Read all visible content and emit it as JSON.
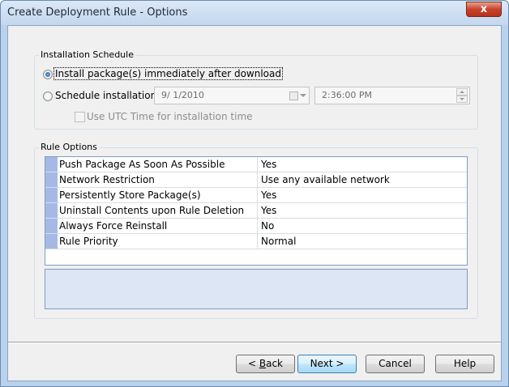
{
  "window": {
    "title": "Create Deployment Rule - Options",
    "close_glyph": "x"
  },
  "installation_schedule": {
    "group_label": "Installation Schedule",
    "immediate_label": "Install package(s) immediately after download",
    "immediate_selected": true,
    "schedule_label": "Schedule installation for",
    "schedule_selected": false,
    "date_value": "9/  1/2010",
    "time_value": "2:36:00 PM",
    "utc_label": "Use UTC Time for installation time",
    "utc_checked": false
  },
  "rule_options": {
    "group_label": "Rule Options",
    "rows": [
      {
        "name": "Push Package As Soon As Possible",
        "value": "Yes"
      },
      {
        "name": "Network Restriction",
        "value": "Use any available network"
      },
      {
        "name": "Persistently Store Package(s)",
        "value": "Yes"
      },
      {
        "name": "Uninstall Contents upon Rule Deletion",
        "value": "Yes"
      },
      {
        "name": "Always Force Reinstall",
        "value": "No"
      },
      {
        "name": "Rule Priority",
        "value": "Normal"
      }
    ]
  },
  "buttons": {
    "back_prefix": "< ",
    "back_key": "B",
    "back_rest": "ack",
    "next": "Next >",
    "cancel": "Cancel",
    "help": "Help"
  },
  "icons": {
    "close": "close-icon",
    "calendar": "calendar-icon",
    "dropdown": "chevron-down-icon",
    "spin_up": "spin-up-icon",
    "spin_down": "spin-down-icon"
  },
  "colors": {
    "window_frame": "#b9d1ea",
    "client_bg": "#f0f0f0",
    "row_marker": "#a6b9e5",
    "description_bg": "#dce6f4",
    "close_button": "#c7432b"
  }
}
